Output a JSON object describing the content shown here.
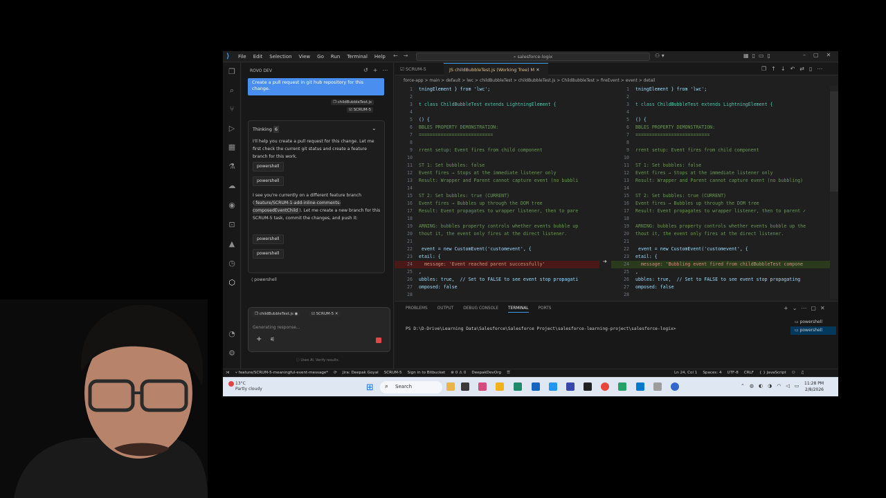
{
  "titlebar": {
    "menu": [
      "File",
      "Edit",
      "Selection",
      "View",
      "Go",
      "Run",
      "Terminal",
      "Help"
    ],
    "search": "salesforce-logix"
  },
  "side_panel": {
    "title": "ROVO DEV",
    "user_message": "Create a pull request in git hub repository for this change.",
    "context_chips": [
      "childBubbleTest.js",
      "SCRUM-5"
    ],
    "thinking_label": "Thinking",
    "thinking_count": "6",
    "para1": "I'll help you create a pull request for this change. Let me first check the current git status and create a feature branch for this work.",
    "ps_label": "powershell",
    "para2_a": "I see you're currently on a different feature branch (",
    "para2_code": "feature/SCRUM-1-add-inline-comments-composedEventChild",
    "para2_b": "). Let me create a new branch for this SCRUM-5 task, commit the changes, and push it:",
    "input_chips": [
      "childBubbleTest.js",
      "SCRUM-5"
    ],
    "input_placeholder": "Generating response...",
    "footer": "Uses AI. Verify results."
  },
  "editor": {
    "tabs": [
      "SCRUM-5",
      "childBubbleTest.js (Working Tree) M"
    ],
    "breadcrumbs": "force-app > main > default > lwc > childBubbleTest > childBubbleTest.js > ChildBubbleTest > fireEvent > event > detail",
    "left_lines": [
      "tningElement } from 'lwc';",
      "",
      "t class ChildBubbleTest extends LightningElement {",
      "",
      "() {",
      "BBLES PROPERTY DEMONSTRATION:",
      "===========================",
      "",
      "rrent setup: Event fires from child component",
      "",
      "ST 1: Set bubbles: false",
      "Event fires → Stops at the immediate listener only",
      "Result: Wrapper and Parent cannot capture event (no bubbli",
      "",
      "ST 2: Set bubbles: true (CURRENT)",
      "Event fires → Bubbles up through the DOM tree",
      "Result: Event propagates to wrapper listener, then to pare",
      "",
      "ARNING: bubbles property controls whether events bubble up",
      "thout it, the event only fires at the direct listener.",
      "",
      " event = new CustomEvent('customevent', {",
      "etail: {",
      "  message: 'Event reached parent successfully'",
      ",",
      "ubbles: true,  // Set to FALSE to see event stop propagati",
      "omposed: false",
      ""
    ],
    "right_lines": [
      "tningElement } from 'lwc';",
      "",
      "t class ChildBubbleTest extends LightningElement {",
      "",
      "() {",
      "BBLES PROPERTY DEMONSTRATION:",
      "===========================",
      "",
      "rrent setup: Event fires from child component",
      "",
      "ST 1: Set bubbles: false",
      "Event fires → Stops at the immediate listener only",
      "Result: Wrapper and Parent cannot capture event (no bubbling)",
      "",
      "ST 2: Set bubbles: true (CURRENT)",
      "Event fires → Bubbles up through the DOM tree",
      "Result: Event propagates to wrapper listener, then to parent ✓",
      "",
      "ARNING: bubbles property controls whether events bubble up the",
      "thout it, the event only fires at the direct listener.",
      "",
      " event = new CustomEvent('customevent', {",
      "etail: {",
      "  message: 'Bubbling event fired from childBubbleTest compone",
      ",",
      "ubbles: true,  // Set to FALSE to see event stop propagating",
      "omposed: false",
      ""
    ],
    "changed_line": 24
  },
  "panel": {
    "tabs": [
      "PROBLEMS",
      "OUTPUT",
      "DEBUG CONSOLE",
      "TERMINAL",
      "PORTS"
    ],
    "active_tab": "TERMINAL",
    "prompt": "PS D:\\D-Drive\\Learning Data\\Salesforce\\Salesforce Project\\salesforce-learning-project\\salesforce-logix>",
    "terminals": [
      "powershell",
      "powershell"
    ]
  },
  "statusbar": {
    "branch": "feature/SCRUM-5-meaningful-event-message*",
    "jira": "Jira: Deepak Goyal",
    "issue": "SCRUM-5",
    "bitbucket": "Sign in to Bitbucket",
    "problems": "⊗ 0 ⚠ 0",
    "org": "DeepakDevOrg",
    "cursor": "Ln 24, Col 1",
    "spaces": "Spaces: 4",
    "encoding": "UTF-8",
    "eol": "CRLF",
    "language": "{ } JavaScript"
  },
  "taskbar": {
    "temp": "13°C",
    "weather": "Partly cloudy",
    "search": "Search",
    "time": "11:28 PM",
    "date": "2/8/2026"
  },
  "colors": {
    "accent": "#3b9cf0",
    "user_bubble": "#4a8ef0",
    "deleted_line": "#4b1818",
    "added_line": "#2a3a1d",
    "stop": "#e04747"
  }
}
